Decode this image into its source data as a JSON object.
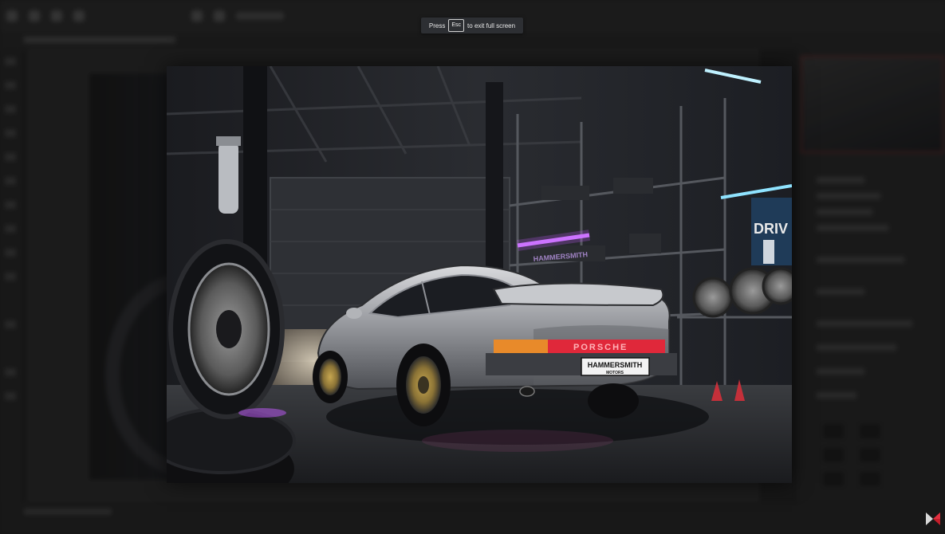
{
  "toast": {
    "press_text": "Press",
    "key_label": "Esc",
    "suffix_text": "to exit full screen"
  },
  "photo": {
    "subject": "silver-porsche-garage-photo",
    "plate_line1": "HAMMERSMITH",
    "plate_line2": "MOTORS",
    "taillight_text": "PORSCHE",
    "poster_text": "DRIV",
    "neon_sign_text": "HAMMERSMITH"
  },
  "colors": {
    "background": "#1e1e1e",
    "toast_background": "#2d2f33",
    "neon_purple": "#c45cff",
    "neon_cyan": "#8fe3ff",
    "taillight_red": "#e0283a",
    "logo_red": "#c41e2a"
  },
  "icons": {
    "corner_logo": "bowtie-logo-icon"
  }
}
